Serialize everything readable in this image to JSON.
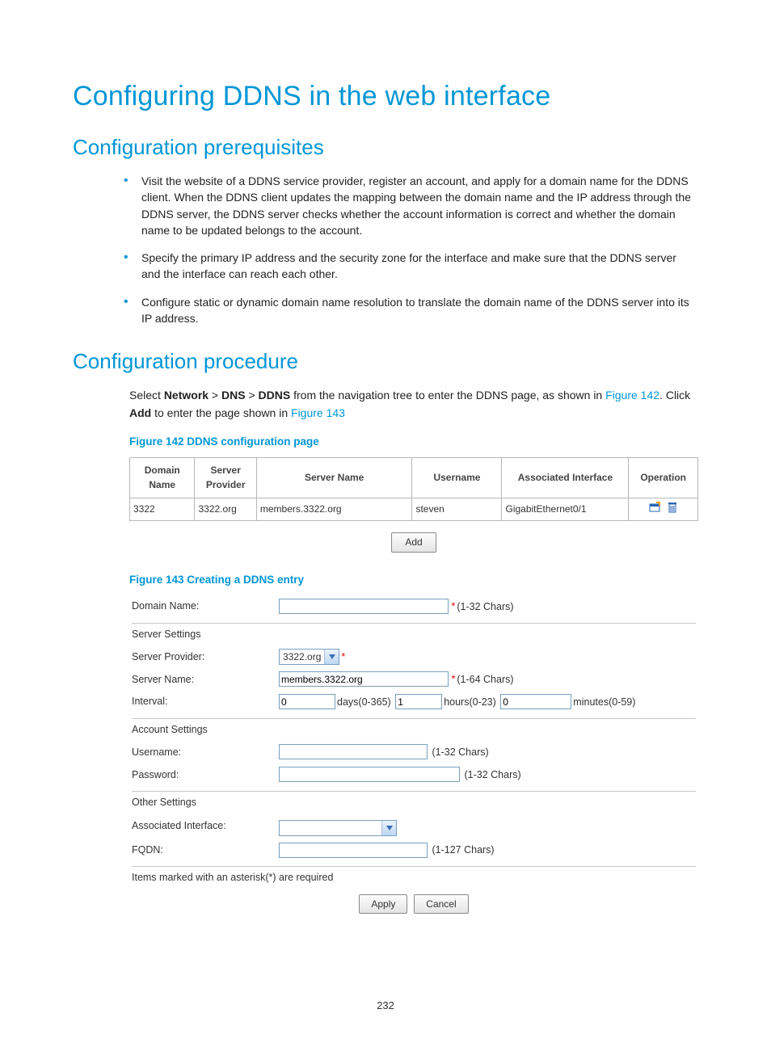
{
  "page_number": "232",
  "h1": "Configuring DDNS in the web interface",
  "h2a": "Configuration prerequisites",
  "prereq": [
    "Visit the website of a DDNS service provider, register an account, and apply for a domain name for the DDNS client. When the DDNS client updates the mapping between the domain name and the IP address through the DDNS server, the DDNS server checks whether the account information is correct and whether the domain name to be updated belongs to the account.",
    "Specify the primary IP address and the security zone for the interface and make sure that the DDNS server and the interface can reach each other.",
    "Configure static or dynamic domain name resolution to translate the domain name of the DDNS server into its IP address."
  ],
  "h2b": "Configuration procedure",
  "proc": {
    "line1_pre": "Select ",
    "bold_network": "Network",
    "sep": " > ",
    "bold_dns": "DNS",
    "bold_ddns": "DDNS",
    "line1_post": " from the navigation tree to enter the DDNS page, as shown in ",
    "link142": "Figure 142",
    "period": ".",
    "line2_pre": "Click ",
    "bold_add": "Add",
    "line2_post": " to enter the page shown in ",
    "link143": "Figure 143"
  },
  "fig142_caption": "Figure 142 DDNS configuration page",
  "table": {
    "headers": [
      "Domain Name",
      "Server Provider",
      "Server Name",
      "Username",
      "Associated Interface",
      "Operation"
    ],
    "row": {
      "domain": "3322",
      "provider": "3322.org",
      "server": "members.3322.org",
      "user": "steven",
      "iface": "GigabitEthernet0/1"
    }
  },
  "add_button": "Add",
  "fig143_caption": "Figure 143 Creating a DDNS entry",
  "form": {
    "domain_label": "Domain Name:",
    "domain_hint": "(1-32 Chars)",
    "server_settings": "Server Settings",
    "provider_label": "Server Provider:",
    "provider_value": "3322.org",
    "server_name_label": "Server Name:",
    "server_name_value": "members.3322.org",
    "server_name_hint": "(1-64 Chars)",
    "interval_label": "Interval:",
    "interval_days": "0",
    "interval_days_hint": "days(0-365)",
    "interval_hours": "1",
    "interval_hours_hint": "hours(0-23)",
    "interval_minutes": "0",
    "interval_minutes_hint": "minutes(0-59)",
    "account_settings": "Account Settings",
    "username_label": "Username:",
    "username_hint": "(1-32 Chars)",
    "password_label": "Password:",
    "password_hint": "(1-32 Chars)",
    "other_settings": "Other Settings",
    "assoc_if_label": "Associated Interface:",
    "fqdn_label": "FQDN:",
    "fqdn_hint": "(1-127 Chars)",
    "required_note": "Items marked with an asterisk(*) are required",
    "apply": "Apply",
    "cancel": "Cancel",
    "star": "*"
  }
}
